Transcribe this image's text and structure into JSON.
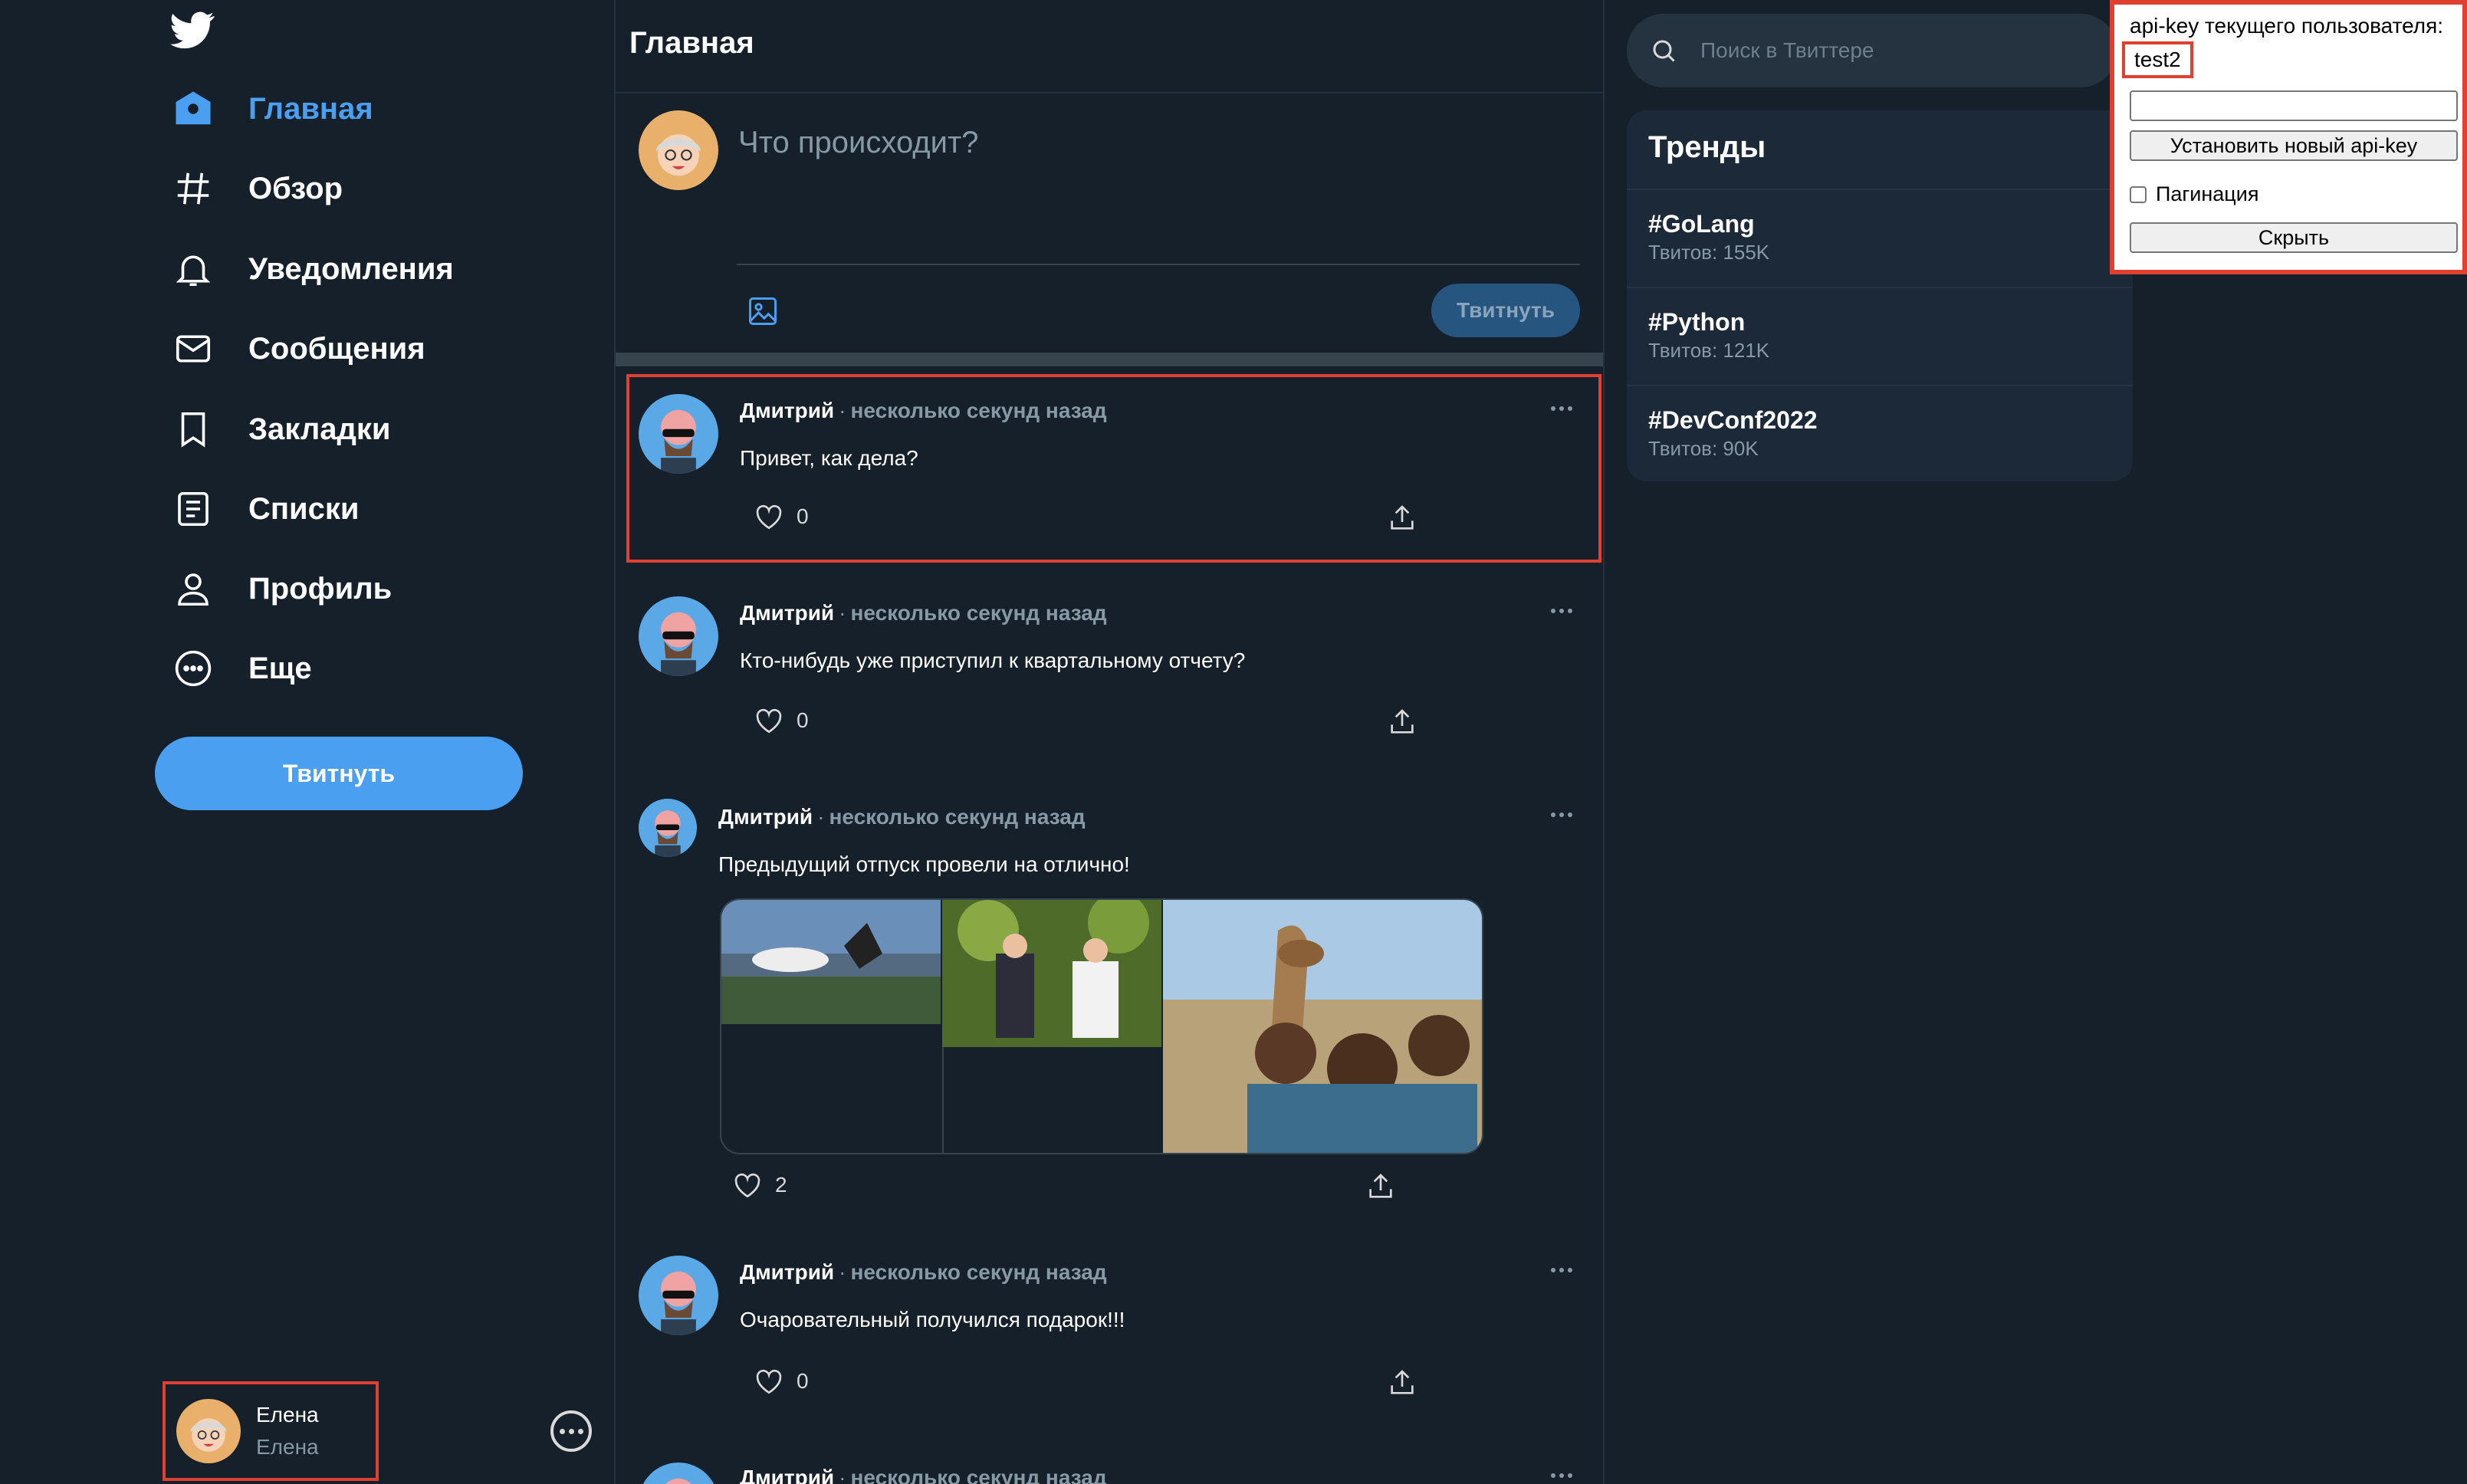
{
  "sidebar": {
    "logo": "twitter-bird-icon",
    "items": [
      {
        "label": "Главная",
        "icon": "home-icon",
        "active": true
      },
      {
        "label": "Обзор",
        "icon": "hashtag-icon"
      },
      {
        "label": "Уведомления",
        "icon": "bell-icon"
      },
      {
        "label": "Сообщения",
        "icon": "mail-icon"
      },
      {
        "label": "Закладки",
        "icon": "bookmark-icon"
      },
      {
        "label": "Списки",
        "icon": "list-icon"
      },
      {
        "label": "Профиль",
        "icon": "person-icon"
      },
      {
        "label": "Еще",
        "icon": "more-circle-icon"
      }
    ],
    "tweet_button": "Твитнуть",
    "user": {
      "name": "Елена",
      "handle": "Елена"
    }
  },
  "main": {
    "title": "Главная",
    "composer": {
      "placeholder": "Что происходит?",
      "submit": "Твитнуть"
    },
    "tweets": [
      {
        "author": "Дмитрий",
        "separator": "·",
        "time": "несколько секунд назад",
        "text": "Привет, как дела?",
        "likes": "0"
      },
      {
        "author": "Дмитрий",
        "separator": "·",
        "time": "несколько секунд назад",
        "text": "Кто-нибудь уже приступил к квартальному отчету?",
        "likes": "0"
      },
      {
        "author": "Дмитрий",
        "separator": "·",
        "time": "несколько секунд назад",
        "text": "Предыдущий отпуск провели на отлично!",
        "likes": "2"
      },
      {
        "author": "Дмитрий",
        "separator": "·",
        "time": "несколько секунд назад",
        "text": "Очаровательный получился подарок!!!",
        "likes": "0"
      },
      {
        "author": "Дмитрий",
        "separator": "·",
        "time": "несколько секунд назад",
        "text": "",
        "likes": ""
      }
    ]
  },
  "right": {
    "search_placeholder": "Поиск в Твиттере",
    "trends_title": "Тренды",
    "trends": [
      {
        "tag": "#GoLang",
        "count": "Твитов: 155K"
      },
      {
        "tag": "#Python",
        "count": "Твитов: 121K"
      },
      {
        "tag": "#DevConf2022",
        "count": "Твитов: 90K"
      }
    ]
  },
  "api_panel": {
    "title": "api-key текущего пользователя:",
    "current_key": "test2",
    "set_button": "Установить новый api-key",
    "pagination_label": "Пагинация",
    "hide_button": "Скрыть"
  },
  "colors": {
    "background": "#15202b",
    "accent": "#4a9ff0",
    "highlight": "#e04030"
  }
}
